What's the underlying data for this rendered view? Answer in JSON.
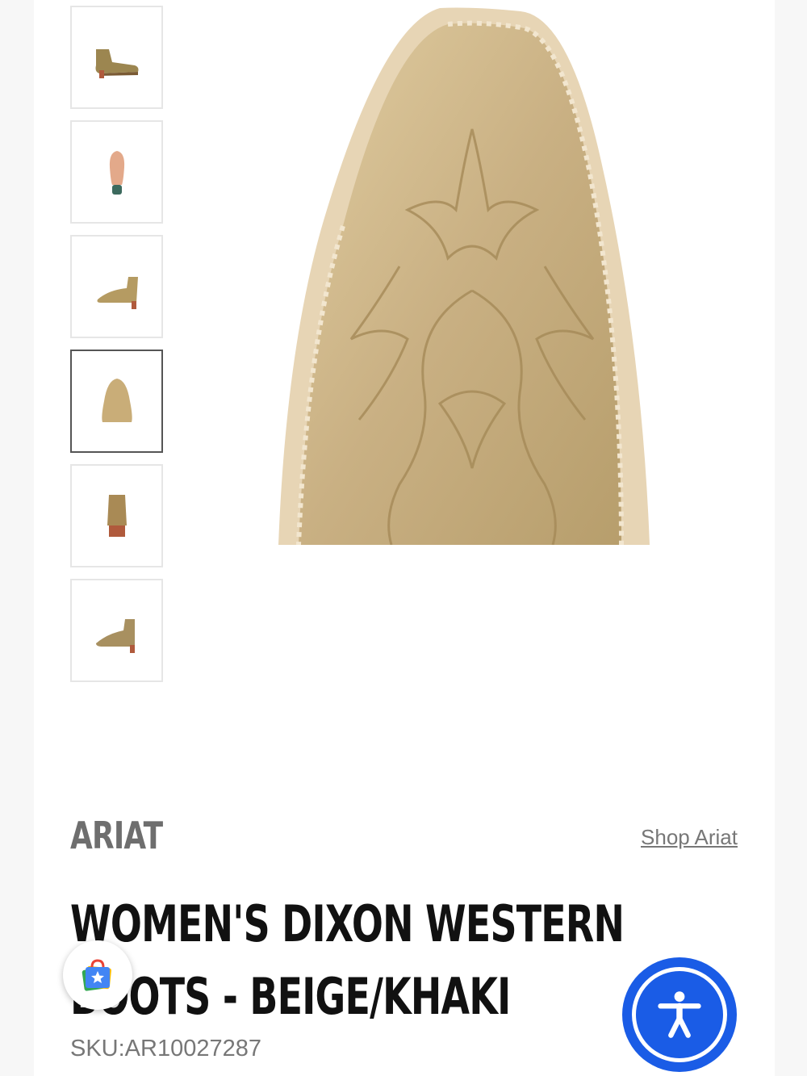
{
  "gallery": {
    "thumbnails": [
      {
        "alt": "boot-side-view"
      },
      {
        "alt": "boot-sole-view"
      },
      {
        "alt": "boot-inner-side-view"
      },
      {
        "alt": "boot-toe-view",
        "active": true
      },
      {
        "alt": "boot-back-view"
      },
      {
        "alt": "boot-angle-view"
      }
    ],
    "main_image_icon": "boot-toe-closeup"
  },
  "product": {
    "brand": "ARIAT",
    "shop_link": "Shop Ariat",
    "title": "WOMEN'S DIXON WESTERN BOOTS - BEIGE/KHAKI",
    "sku": "SKU:AR10027287"
  },
  "floating": {
    "shop_icon": "shopping-bag-star-icon",
    "accessibility_icon": "accessibility-person-icon",
    "accessibility_color": "#1a5ce6"
  },
  "colors": {
    "boot_leather": "#cdb485",
    "boot_sole": "#c07a56"
  }
}
